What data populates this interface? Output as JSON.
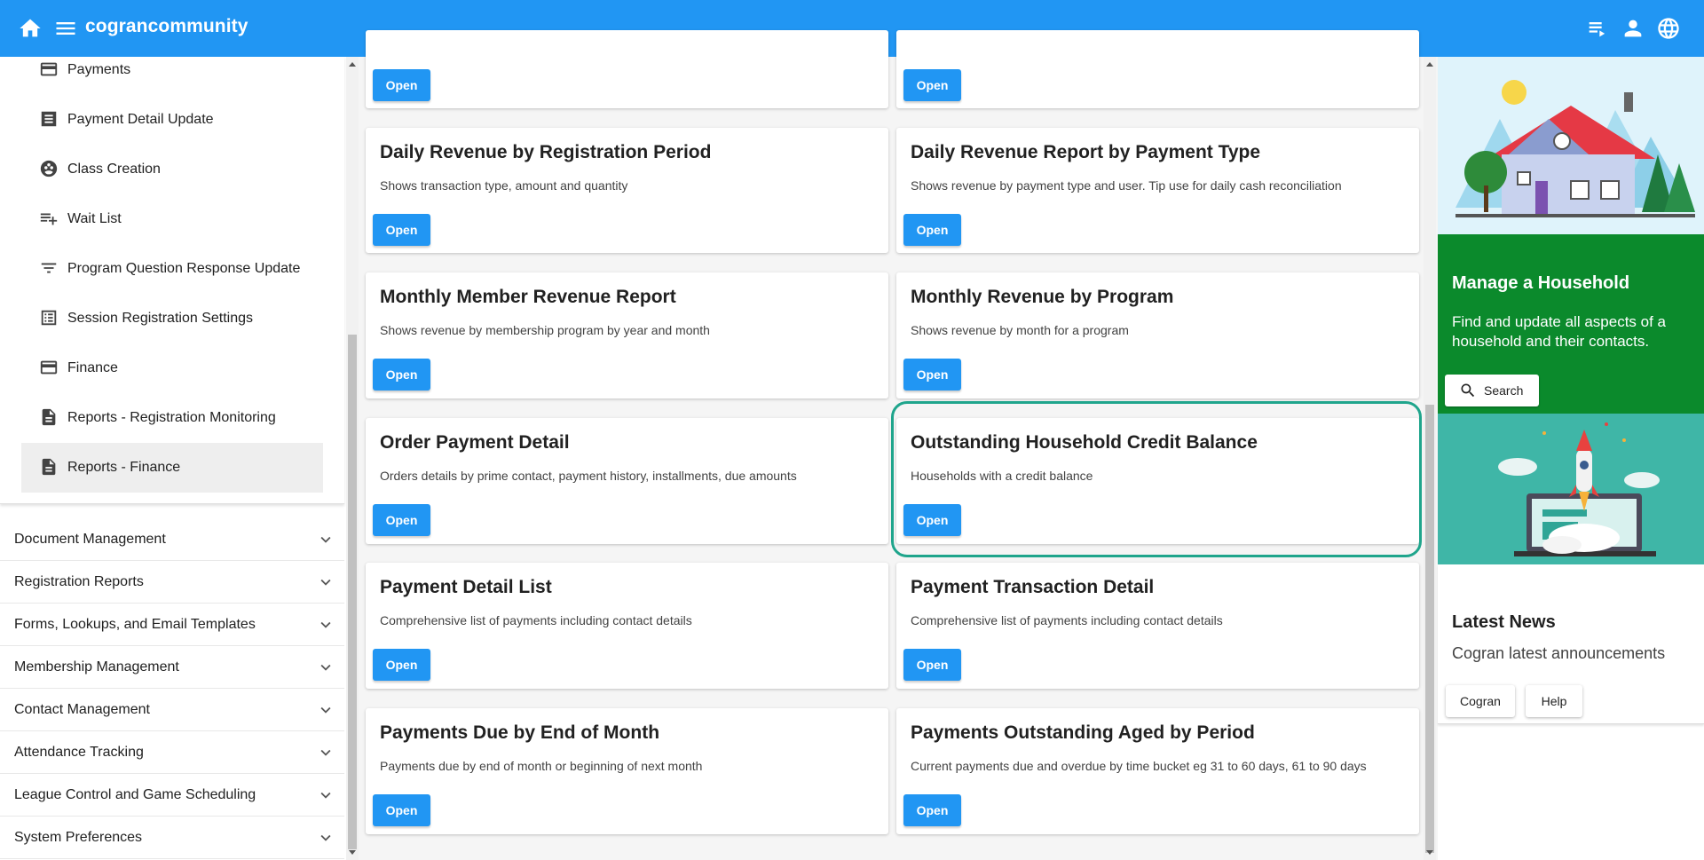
{
  "header": {
    "brand": "cograncommunity",
    "icons": [
      "home-icon",
      "menu-icon",
      "playlist-icon",
      "account-icon",
      "globe-icon"
    ]
  },
  "sidebar": {
    "sub_items": [
      {
        "label": "Payments",
        "icon": "credit-card-icon"
      },
      {
        "label": "Payment Detail Update",
        "icon": "list-box-icon"
      },
      {
        "label": "Class Creation",
        "icon": "group-circle-icon"
      },
      {
        "label": "Wait List",
        "icon": "playlist-add-icon"
      },
      {
        "label": "Program Question Response Update",
        "icon": "filter-icon"
      },
      {
        "label": "Session Registration Settings",
        "icon": "checklist-icon"
      },
      {
        "label": "Finance",
        "icon": "credit-card-icon"
      },
      {
        "label": "Reports - Registration Monitoring",
        "icon": "document-icon"
      },
      {
        "label": "Reports - Finance",
        "icon": "document-icon",
        "active": true
      }
    ],
    "groups": [
      "Document Management",
      "Registration Reports",
      "Forms, Lookups, and Email Templates",
      "Membership Management",
      "Contact Management",
      "Attendance Tracking",
      "League Control and Game Scheduling",
      "System Preferences"
    ]
  },
  "main": {
    "open_label": "Open",
    "cards": [
      {
        "title": "",
        "desc": ""
      },
      {
        "title": "",
        "desc": ""
      },
      {
        "title": "Daily Revenue by Registration Period",
        "desc": "Shows transaction type, amount and quantity"
      },
      {
        "title": "Daily Revenue Report by Payment Type",
        "desc": "Shows revenue by payment type and user. Tip use for daily cash reconciliation"
      },
      {
        "title": "Monthly Member Revenue Report",
        "desc": "Shows revenue by membership program by year and month"
      },
      {
        "title": "Monthly Revenue by Program",
        "desc": "Shows revenue by month for a program"
      },
      {
        "title": "Order Payment Detail",
        "desc": "Orders details by prime contact, payment history, installments, due amounts"
      },
      {
        "title": "Outstanding Household Credit Balance",
        "desc": "Households with a credit balance"
      },
      {
        "title": "Payment Detail List",
        "desc": "Comprehensive list of payments including contact details"
      },
      {
        "title": "Payment Transaction Detail",
        "desc": "Comprehensive list of payments including contact details"
      },
      {
        "title": "Payments Due by End of Month",
        "desc": "Payments due by end of month or beginning of next month"
      },
      {
        "title": "Payments Outstanding Aged by Period",
        "desc": "Current payments due and overdue by time bucket eg 31 to 60 days, 61 to 90 days"
      }
    ]
  },
  "right": {
    "manage_title": "Manage a Household",
    "manage_desc": "Find and update all aspects of a household and their contacts.",
    "search_label": "Search",
    "news_title": "Latest News",
    "news_desc": "Cogran latest announcements",
    "news_buttons": [
      "Cogran",
      "Help"
    ]
  },
  "colors": {
    "primary": "#2196f3",
    "manage_bg": "#0b8a2c",
    "rocket_bg": "#3fb6a7",
    "highlight": "#1fa58c"
  }
}
